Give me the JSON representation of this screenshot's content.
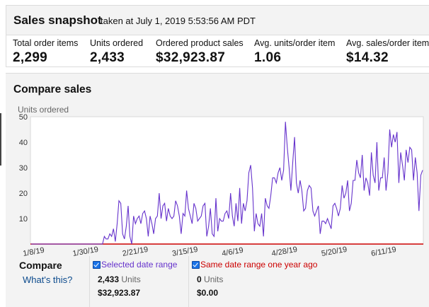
{
  "snapshot": {
    "title": "Sales snapshot",
    "subtitle": "taken at July 1, 2019 5:53:56 AM PDT",
    "metrics": [
      {
        "label": "Total order items",
        "value": "2,299"
      },
      {
        "label": "Units ordered",
        "value": "2,433"
      },
      {
        "label": "Ordered product sales",
        "value": "$32,923.87"
      },
      {
        "label": "Avg. units/order item",
        "value": "1.06"
      },
      {
        "label": "Avg. sales/order item",
        "value": "$14.32"
      }
    ]
  },
  "compare": {
    "title": "Compare sales",
    "legend_title": "Compare",
    "whats_this": "What's this?",
    "selected": {
      "label": "Selected date range",
      "color": "#6633cc",
      "checked": true,
      "units_value": "2,433",
      "units_word": "Units",
      "sales": "$32,923.87"
    },
    "last_year": {
      "label": "Same date range one year ago",
      "color": "#cc0000",
      "checked": true,
      "units_value": "0",
      "units_word": "Units",
      "sales": "$0.00"
    }
  },
  "chart_data": {
    "type": "line",
    "ylabel": "Units ordered",
    "ylim": [
      0,
      50
    ],
    "y_ticks": [
      "10",
      "20",
      "30",
      "40",
      "50"
    ],
    "x_tick_labels": [
      "1/8/19",
      "1/30/19",
      "2/21/19",
      "3/15/19",
      "4/6/19",
      "4/28/19",
      "5/20/19",
      "6/11/19"
    ],
    "grid": false,
    "series": [
      {
        "name": "Selected date range",
        "color": "#6633cc",
        "values": [
          0,
          0,
          0,
          0,
          0,
          0,
          0,
          0,
          0,
          0,
          0,
          0,
          0,
          0,
          0,
          0,
          0,
          0,
          0,
          0,
          0,
          0,
          0,
          0,
          0,
          0,
          0,
          0,
          0,
          0,
          0,
          0,
          0,
          0,
          0,
          0,
          0,
          0,
          0,
          0,
          3,
          2,
          2,
          4,
          3,
          6,
          1,
          8,
          17,
          16,
          4,
          2,
          7,
          15,
          3,
          0,
          11,
          8,
          10,
          11,
          8,
          12,
          13,
          10,
          3,
          11,
          8,
          4,
          10,
          11,
          20,
          10,
          15,
          16,
          9,
          14,
          11,
          10,
          11,
          17,
          15,
          11,
          4,
          12,
          11,
          21,
          14,
          11,
          8,
          16,
          14,
          9,
          10,
          11,
          15,
          16,
          3,
          7,
          14,
          4,
          3,
          18,
          5,
          10,
          9,
          9,
          12,
          13,
          10,
          20,
          11,
          7,
          16,
          9,
          22,
          8,
          16,
          13,
          17,
          28,
          31,
          22,
          5,
          12,
          8,
          7,
          12,
          3,
          18,
          15,
          14,
          19,
          26,
          26,
          24,
          28,
          30,
          25,
          29,
          48,
          38,
          30,
          21,
          32,
          42,
          24,
          20,
          25,
          21,
          13,
          14,
          21,
          23,
          22,
          13,
          11,
          13,
          15,
          4,
          9,
          9,
          8,
          10,
          8,
          6,
          15,
          16,
          14,
          11,
          14,
          23,
          18,
          20,
          25,
          13,
          16,
          25,
          25,
          33,
          28,
          26,
          35,
          21,
          26,
          24,
          19,
          36,
          27,
          24,
          40,
          21,
          26,
          26,
          34,
          21,
          28,
          45,
          38,
          43,
          40,
          44,
          24,
          36,
          31,
          25,
          37,
          32,
          38,
          37,
          25,
          34,
          28,
          13,
          27,
          29
        ]
      },
      {
        "name": "Same date range one year ago",
        "color": "#cc0000",
        "values": "all zero"
      }
    ]
  }
}
